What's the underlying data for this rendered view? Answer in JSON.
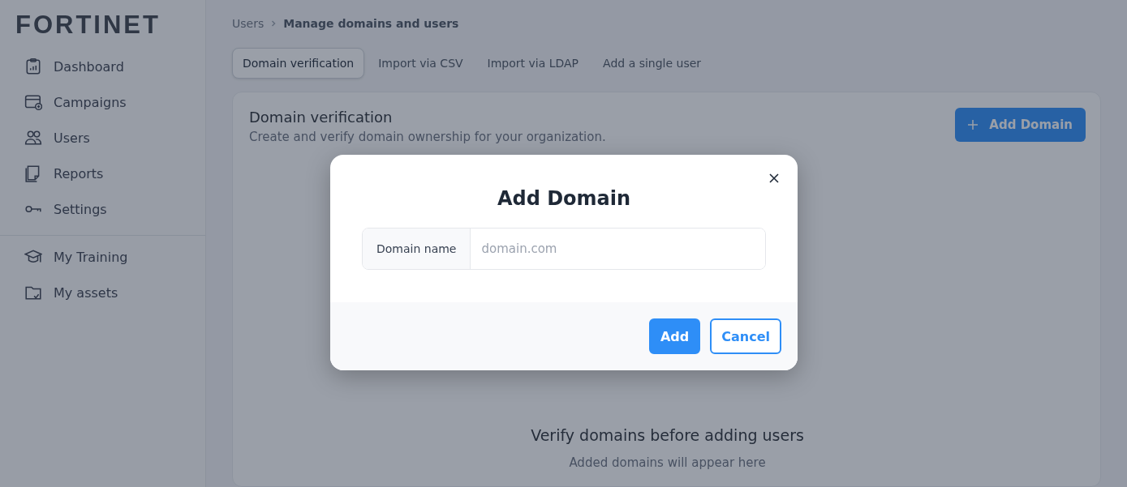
{
  "logo": {
    "text": "FORTINET"
  },
  "sidebar": {
    "items": [
      {
        "label": "Dashboard",
        "selected": false
      },
      {
        "label": "Campaigns",
        "selected": false
      },
      {
        "label": "Users",
        "selected": false
      },
      {
        "label": "Reports",
        "selected": false
      },
      {
        "label": "Settings",
        "selected": false
      }
    ],
    "secondary_items": [
      {
        "label": "My Training",
        "selected": false
      },
      {
        "label": "My assets",
        "selected": false
      }
    ]
  },
  "breadcrumb": [
    "Users",
    "Manage domains and users"
  ],
  "tabs": [
    {
      "label": "Domain verification",
      "selected": true
    },
    {
      "label": "Import via CSV",
      "selected": false
    },
    {
      "label": "Import via LDAP",
      "selected": false
    },
    {
      "label": "Add a single user",
      "selected": false
    }
  ],
  "card": {
    "title": "Domain verification",
    "subtitle": "Create and verify domain ownership for your organization.",
    "button": "Add Domain",
    "empty_title": "Verify domains before adding users",
    "empty_text": "Added domains will appear here"
  },
  "modal": {
    "title": "Add Domain",
    "field_label": "Domain name",
    "placeholder": "domain.com",
    "buttons": [
      {
        "label": "Add",
        "kind": "primary"
      },
      {
        "label": "Cancel",
        "kind": "secondary"
      }
    ]
  }
}
